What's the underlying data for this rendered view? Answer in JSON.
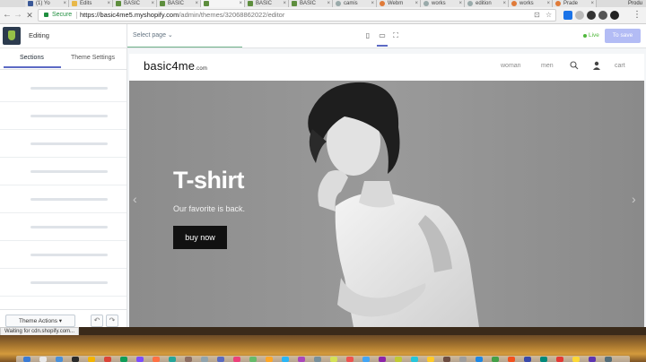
{
  "browser": {
    "tabs": [
      {
        "label": "(1) Yo",
        "style": "fav-blue"
      },
      {
        "label": "Edits",
        "style": "fav-yellow"
      },
      {
        "label": "BASIC",
        "style": ""
      },
      {
        "label": "BASIC",
        "style": ""
      },
      {
        "label": "",
        "style": "",
        "active": true
      },
      {
        "label": "BASIC",
        "style": ""
      },
      {
        "label": "BASIC",
        "style": ""
      },
      {
        "label": "camis",
        "style": "fav-gray"
      },
      {
        "label": "Webm",
        "style": "fav-orange"
      },
      {
        "label": "works",
        "style": "fav-gray"
      },
      {
        "label": "edition",
        "style": "fav-gray"
      },
      {
        "label": "works",
        "style": "fav-orange"
      },
      {
        "label": "Prade",
        "style": "fav-orange"
      }
    ],
    "profile": "Produ",
    "secure_label": "Secure",
    "url_host": "https://basic4me5.myshopify.com",
    "url_path": "/admin/themes/32068862022/editor",
    "status_text": "Waiting for cdn.shopify.com..."
  },
  "editor": {
    "sidebar_title": "Editing",
    "tabs": {
      "sections": "Sections",
      "theme_settings": "Theme Settings"
    },
    "theme_actions": "Theme Actions ▾",
    "select_page": "Select page ⌄",
    "live_label": "Live",
    "save_label": "To save"
  },
  "site": {
    "logo": "basic4me",
    "logo_tld": ".com",
    "nav": {
      "woman": "woman",
      "men": "men",
      "cart": "cart"
    },
    "hero": {
      "title": "T-shirt",
      "subtitle": "Our favorite is back.",
      "cta": "buy now"
    }
  },
  "icons": {
    "search": "search-icon",
    "account": "user-icon",
    "undo": "undo-icon",
    "redo": "redo-icon"
  }
}
